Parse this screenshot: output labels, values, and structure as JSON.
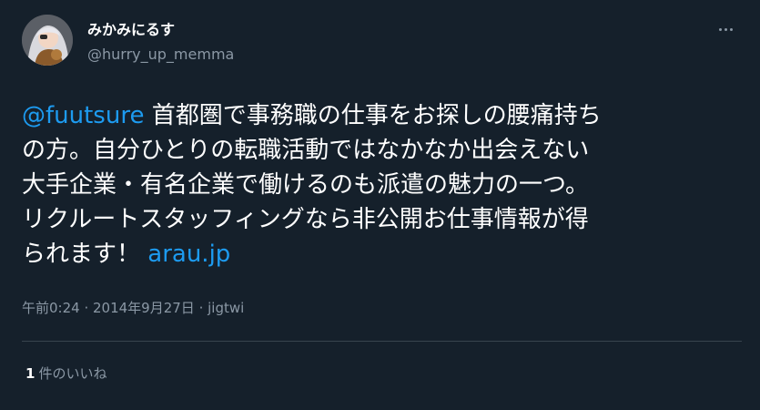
{
  "author": {
    "display_name": "みかみにるす",
    "handle": "@hurry_up_memma"
  },
  "tweet": {
    "mention": "@fuutsure",
    "text_line1": " 首都圏で事務職の仕事をお探しの腰痛持ち",
    "text_rest": "の方。自分ひとりの転職活動ではなかなか出会えない\n大手企業・有名企業で働けるのも派遣の魅力の一つ。\nリクルートスタッフィングなら非公開お仕事情報が得\nられます！ ",
    "link": "arau.jp"
  },
  "meta": {
    "time": "午前0:24",
    "separator": " · ",
    "date": "2014年9月27日",
    "source": "jigtwi"
  },
  "likes": {
    "count": "1",
    "label": "件のいいね"
  },
  "icons": {
    "more": "more-horizontal-icon"
  },
  "colors": {
    "background": "#15202b",
    "link": "#1d9bf0",
    "secondary_text": "#8b98a5",
    "divider": "#38444d"
  }
}
